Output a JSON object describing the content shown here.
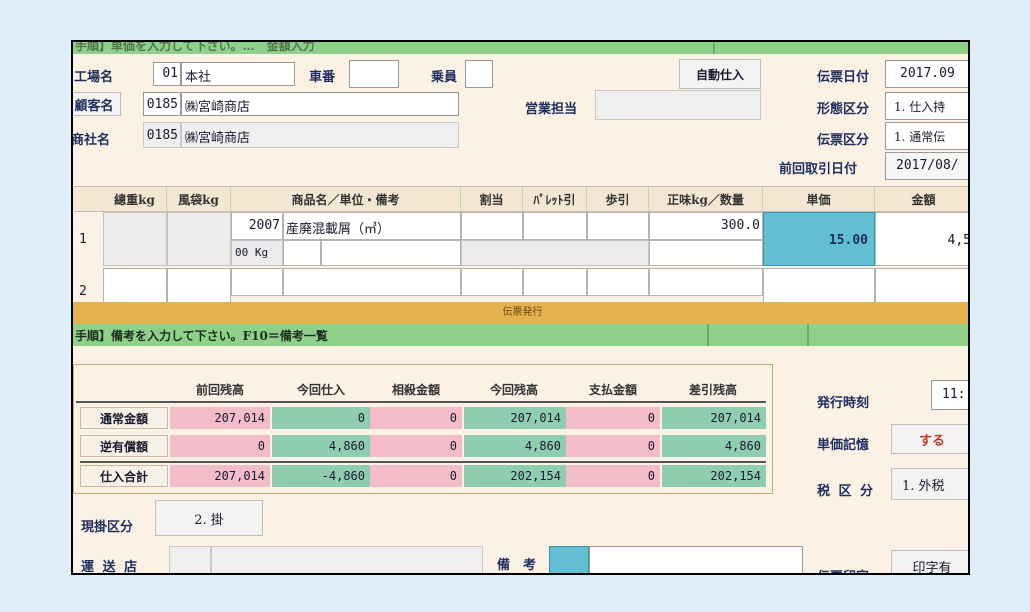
{
  "top_bar": {
    "text": "手順】単価を入力して下さい。…　金額入力",
    "mode": ""
  },
  "header": {
    "factory_label": "工場名",
    "factory_code": "01",
    "factory_name": "本社",
    "car_label": "車番",
    "car_value": "",
    "crew_label": "乗員",
    "crew_value": "",
    "auto_button": "自動仕入",
    "slip_date_label": "伝票日付",
    "slip_date_value": "2017.09",
    "customer_button": "顧客名",
    "customer_code": "0185",
    "customer_name": "㈱宮崎商店",
    "sales_label": "営業担当",
    "sales_value": "",
    "form_type_label": "形態区分",
    "form_type_value": "1. 仕入持",
    "company_label": "商社名",
    "company_code": "0185",
    "company_name": "㈱宮崎商店",
    "slip_type_label": "伝票区分",
    "slip_type_value": "1. 通常伝",
    "last_date_label": "前回取引日付",
    "last_date_value": "2017/08/"
  },
  "grid": {
    "columns": [
      "總重kg",
      "風袋kg",
      "商品名／単位・備考",
      "割当",
      "ﾊﾟﾚｯﾄ引",
      "歩引",
      "正味kg／数量",
      "単価",
      "金額"
    ],
    "rows": [
      {
        "no": "1",
        "code": "2007",
        "name": "産廃混載屑（㎥）",
        "unit": "00 Kg",
        "net": "300.0",
        "price": "15.00",
        "amount": "4,5"
      },
      {
        "no": "2",
        "code": "",
        "name": "",
        "unit": "",
        "net": "",
        "price": "",
        "amount": ""
      }
    ]
  },
  "status_bar": {
    "text": "伝票発行"
  },
  "instruction": {
    "text": "手順】備考を入力して下さい。F10＝備考一覧"
  },
  "summary": {
    "columns": [
      "前回残高",
      "今回仕入",
      "相殺金額",
      "今回残高",
      "支払金額",
      "差引残高"
    ],
    "rows": [
      {
        "label": "通常金額",
        "values": [
          "207,014",
          "0",
          "0",
          "207,014",
          "0",
          "207,014"
        ]
      },
      {
        "label": "逆有償額",
        "values": [
          "0",
          "4,860",
          "0",
          "4,860",
          "0",
          "4,860"
        ]
      },
      {
        "label": "仕入合計",
        "values": [
          "207,014",
          "-4,860",
          "0",
          "202,154",
          "0",
          "202,154"
        ]
      }
    ]
  },
  "right_panel": {
    "issue_time_label": "発行時刻",
    "issue_time_value": "11:",
    "price_memory_label": "単価記憶",
    "price_memory_value": "する",
    "tax_label": "税 区 分",
    "tax_value": "1. 外税"
  },
  "payment": {
    "label": "現掛区分",
    "value": "2. 掛"
  },
  "bottom": {
    "shipper_label": "運 送 店",
    "note_label": "備　考",
    "slip_print_label": "伝票印字",
    "slip_print_value": "印字有"
  },
  "colors": {
    "green_bar": "#8fd08a",
    "gold_bar": "#e4b24e",
    "pink": "#f4bcc9",
    "green": "#8fcdb0",
    "cyan": "#62bfd3"
  }
}
